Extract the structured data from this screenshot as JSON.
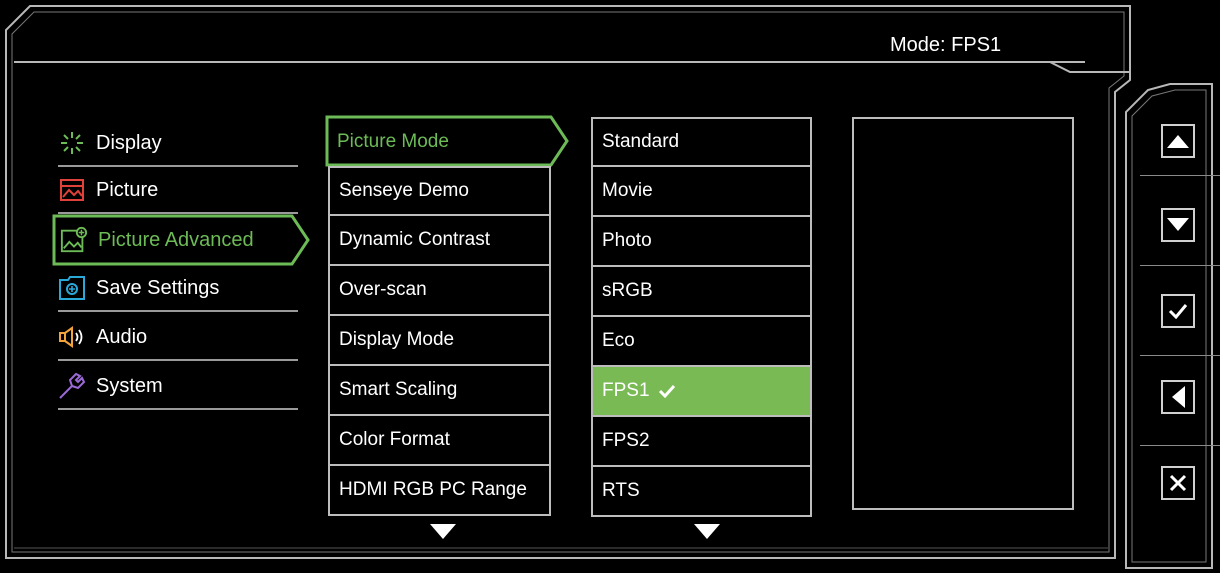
{
  "header": {
    "mode_label": "Mode: FPS1"
  },
  "categories": [
    {
      "label": "Display",
      "icon": "display-icon"
    },
    {
      "label": "Picture",
      "icon": "picture-icon"
    },
    {
      "label": "Picture Advanced",
      "icon": "picture-advanced-icon",
      "active": true
    },
    {
      "label": "Save Settings",
      "icon": "save-settings-icon"
    },
    {
      "label": "Audio",
      "icon": "audio-icon"
    },
    {
      "label": "System",
      "icon": "system-icon"
    }
  ],
  "submenu": {
    "items": [
      "Picture Mode",
      "Senseye Demo",
      "Dynamic Contrast",
      "Over-scan",
      "Display Mode",
      "Smart Scaling",
      "Color Format",
      "HDMI RGB PC Range"
    ],
    "active_index": 0
  },
  "options": {
    "items": [
      "Standard",
      "Movie",
      "Photo",
      "sRGB",
      "Eco",
      "FPS1",
      "FPS2",
      "RTS"
    ],
    "selected_index": 5
  },
  "side_buttons": [
    "up-button",
    "down-button",
    "confirm-button",
    "back-button",
    "exit-button"
  ],
  "colors": {
    "accent_green": "#6dbb57",
    "highlight_green": "#7aba55",
    "background": "#000000"
  }
}
